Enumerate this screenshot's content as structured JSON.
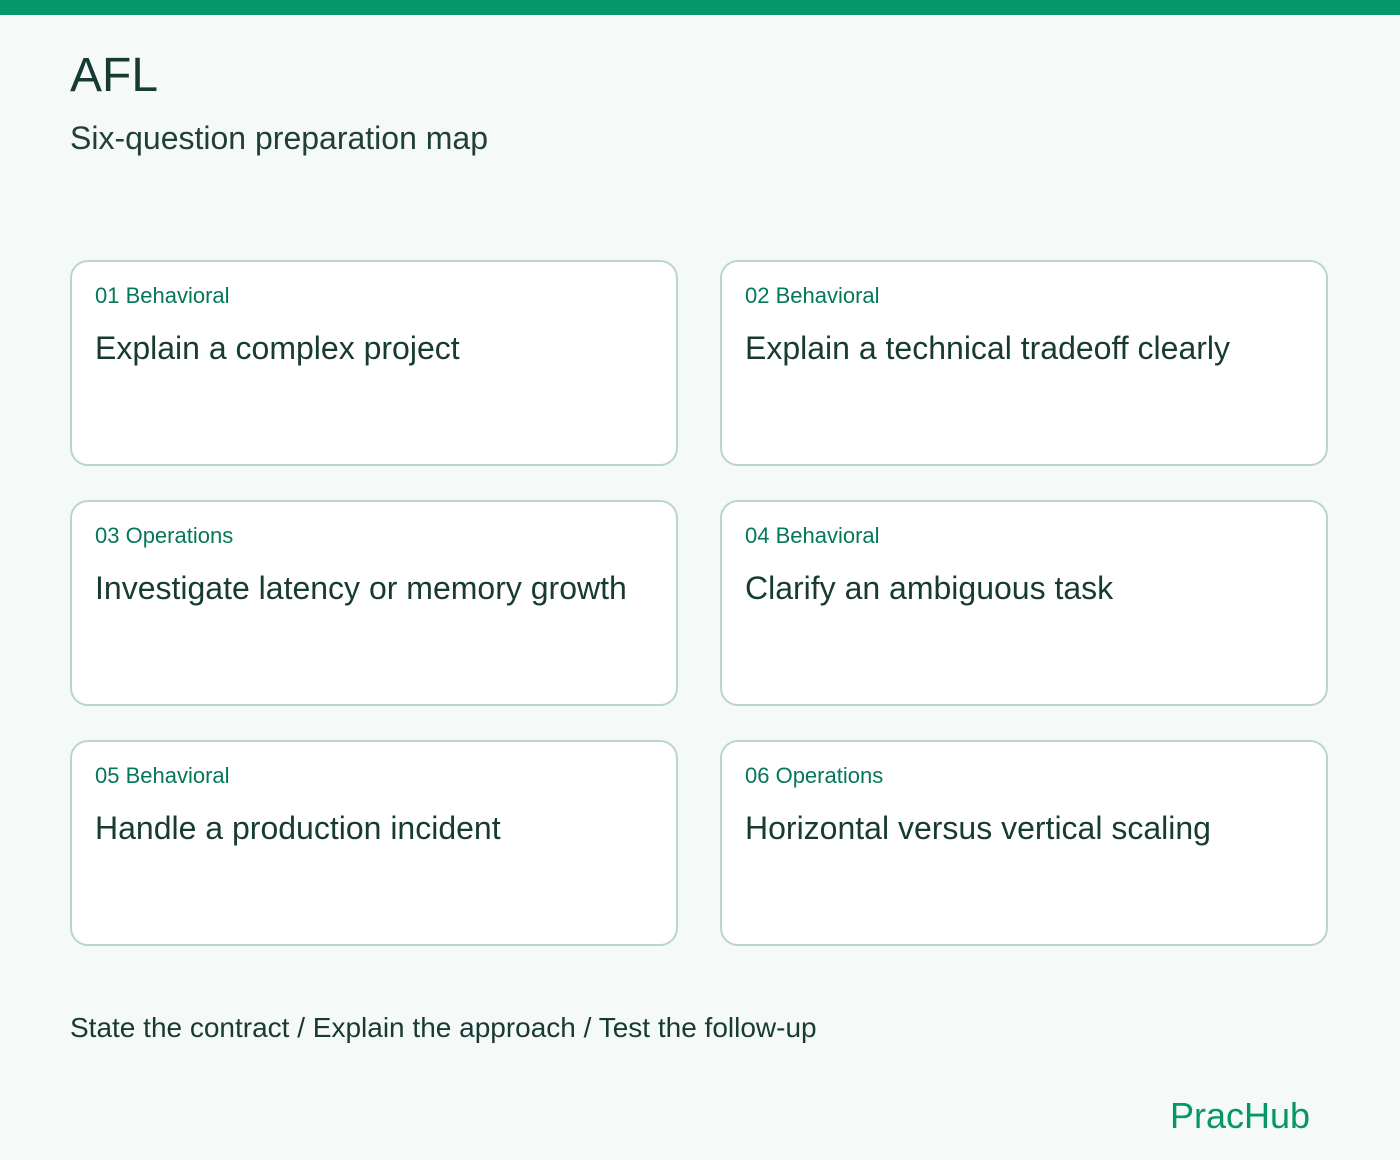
{
  "header": {
    "title": "AFL",
    "subtitle": "Six-question preparation map"
  },
  "cards": [
    {
      "tag": "01 Behavioral",
      "title": "Explain a complex project"
    },
    {
      "tag": "02 Behavioral",
      "title": "Explain a technical tradeoff clearly"
    },
    {
      "tag": "03 Operations",
      "title": "Investigate latency or memory growth"
    },
    {
      "tag": "04 Behavioral",
      "title": "Clarify an ambiguous task"
    },
    {
      "tag": "05 Behavioral",
      "title": "Handle a production incident"
    },
    {
      "tag": "06 Operations",
      "title": "Horizontal versus vertical scaling"
    }
  ],
  "footer": {
    "steps": "State the contract / Explain the approach / Test the follow-up"
  },
  "brand": {
    "name": "PracHub"
  },
  "colors": {
    "accent": "#059669",
    "background": "#f5f9f7",
    "card_border": "#b9d6cc",
    "text": "#173a33"
  }
}
